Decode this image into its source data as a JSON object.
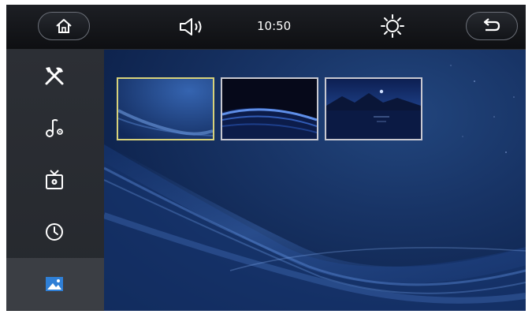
{
  "status_bar": {
    "time": "10:50",
    "icons": {
      "home": "home-icon",
      "volume": "volume-icon",
      "brightness": "brightness-icon",
      "back": "back-arrow-icon"
    }
  },
  "sidebar": {
    "items": [
      {
        "icon": "tools-icon",
        "selected": false
      },
      {
        "icon": "music-settings-icon",
        "selected": false
      },
      {
        "icon": "tv-settings-icon",
        "selected": false
      },
      {
        "icon": "clock-icon",
        "selected": false
      },
      {
        "icon": "wallpaper-icon",
        "selected": true
      }
    ]
  },
  "wallpapers": {
    "selected_index": 0,
    "thumbnails": [
      {
        "name": "blue-waves"
      },
      {
        "name": "dark-wave"
      },
      {
        "name": "night-lake"
      }
    ]
  },
  "colors": {
    "accent_selected": "#d8d27a",
    "icon_white": "#ffffff",
    "wallpaper_icon": "#2f7fd6"
  }
}
